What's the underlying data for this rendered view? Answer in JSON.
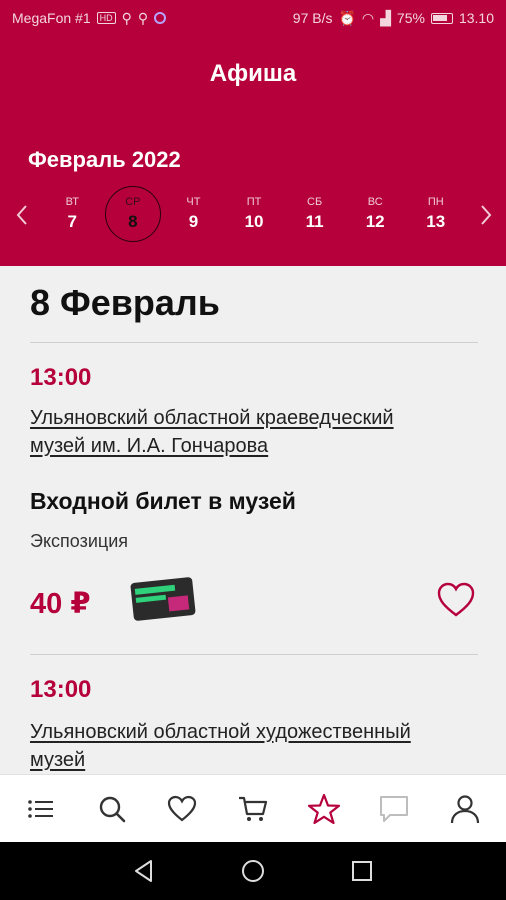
{
  "status_bar": {
    "carrier": "MegaFon #1",
    "badge": "HD",
    "speed": "97 B/s",
    "battery": "75%",
    "time": "13.10"
  },
  "header": {
    "title": "Афиша",
    "month": "Февраль 2022",
    "days": [
      {
        "name": "ВТ",
        "num": "7",
        "selected": false
      },
      {
        "name": "СР",
        "num": "8",
        "selected": true
      },
      {
        "name": "ЧТ",
        "num": "9",
        "selected": false
      },
      {
        "name": "ПТ",
        "num": "10",
        "selected": false
      },
      {
        "name": "СБ",
        "num": "11",
        "selected": false
      },
      {
        "name": "ВС",
        "num": "12",
        "selected": false
      },
      {
        "name": "ПН",
        "num": "13",
        "selected": false
      }
    ]
  },
  "main": {
    "date_heading": "8 Февраль",
    "events": [
      {
        "time": "13:00",
        "venue_line1": "Ульяновский областной краеведческий",
        "venue_line2": "музей им. И.А. Гончарова",
        "title": "Входной билет в музей",
        "type": "Экспозиция",
        "price": "40 ₽"
      },
      {
        "time": "13:00",
        "venue_line1": "Ульяновский областной художественный",
        "venue_line2": "музей"
      }
    ]
  },
  "bottom_nav": {
    "items": [
      "menu-icon",
      "search-icon",
      "heart-icon",
      "cart-icon",
      "star-icon",
      "chat-icon",
      "profile-icon"
    ],
    "active": "star-icon"
  },
  "colors": {
    "brand": "#b5003c",
    "background": "#f0f0f0"
  }
}
